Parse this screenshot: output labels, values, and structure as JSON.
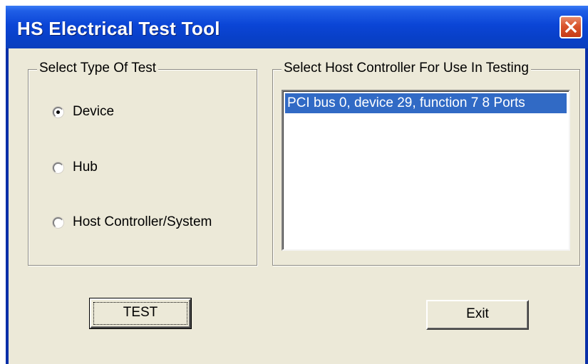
{
  "window": {
    "title": "HS Electrical Test Tool",
    "close_icon": "close-icon"
  },
  "test_type_group": {
    "legend": "Select Type Of Test",
    "options": [
      {
        "label": "Device",
        "selected": true
      },
      {
        "label": "Hub",
        "selected": false
      },
      {
        "label": "Host Controller/System",
        "selected": false
      }
    ]
  },
  "host_controller_group": {
    "legend": "Select Host Controller For Use In Testing",
    "items": [
      {
        "label": "PCI bus 0, device 29, function 7  8 Ports",
        "selected": true
      }
    ]
  },
  "buttons": {
    "test_label": "TEST",
    "exit_label": "Exit"
  },
  "colors": {
    "titlebar": "#0b45d6",
    "close_button": "#d9542c",
    "dialog_face": "#ece9d8",
    "selection": "#316ac5"
  }
}
